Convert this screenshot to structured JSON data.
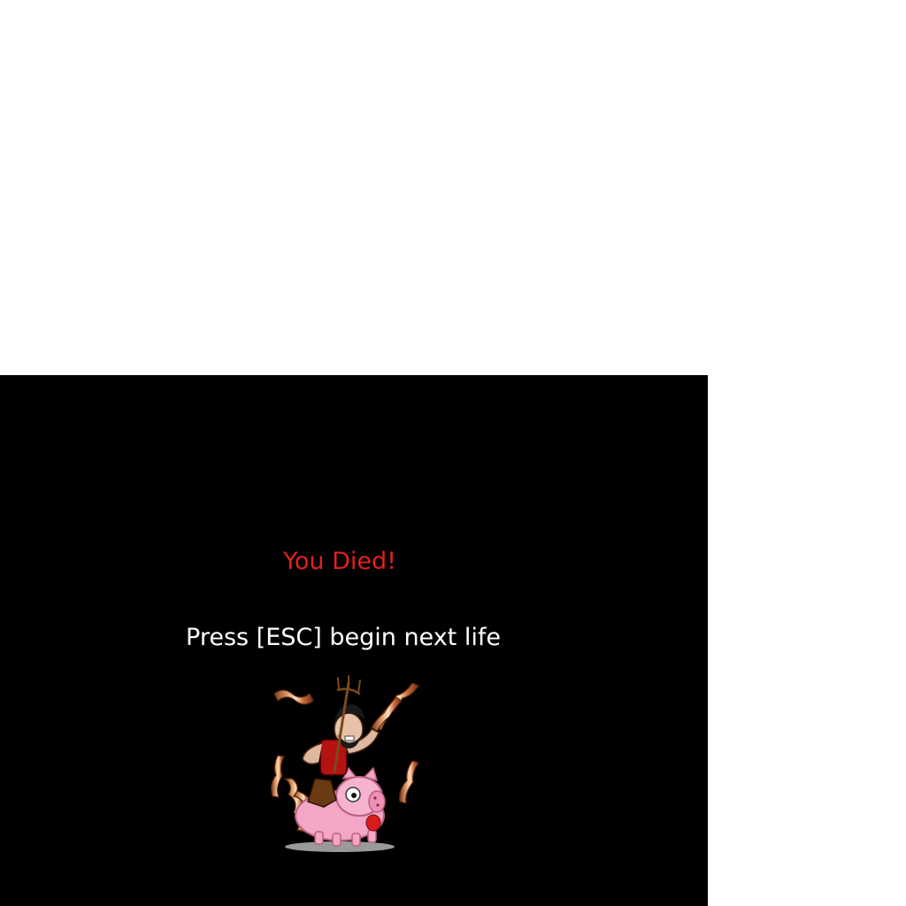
{
  "screen": {
    "background_color": "#000000",
    "page_background_color": "#ffffff"
  },
  "death_message": {
    "title": "You Died!",
    "title_color": "#e02020",
    "prompt": "Press [ESC] begin next life",
    "prompt_color": "#ffffff"
  },
  "illustration": {
    "subject": "cartoon man with pitchfork riding a pink pig surrounded by bacon strips",
    "icon": "bacon-pig-rider-icon"
  }
}
